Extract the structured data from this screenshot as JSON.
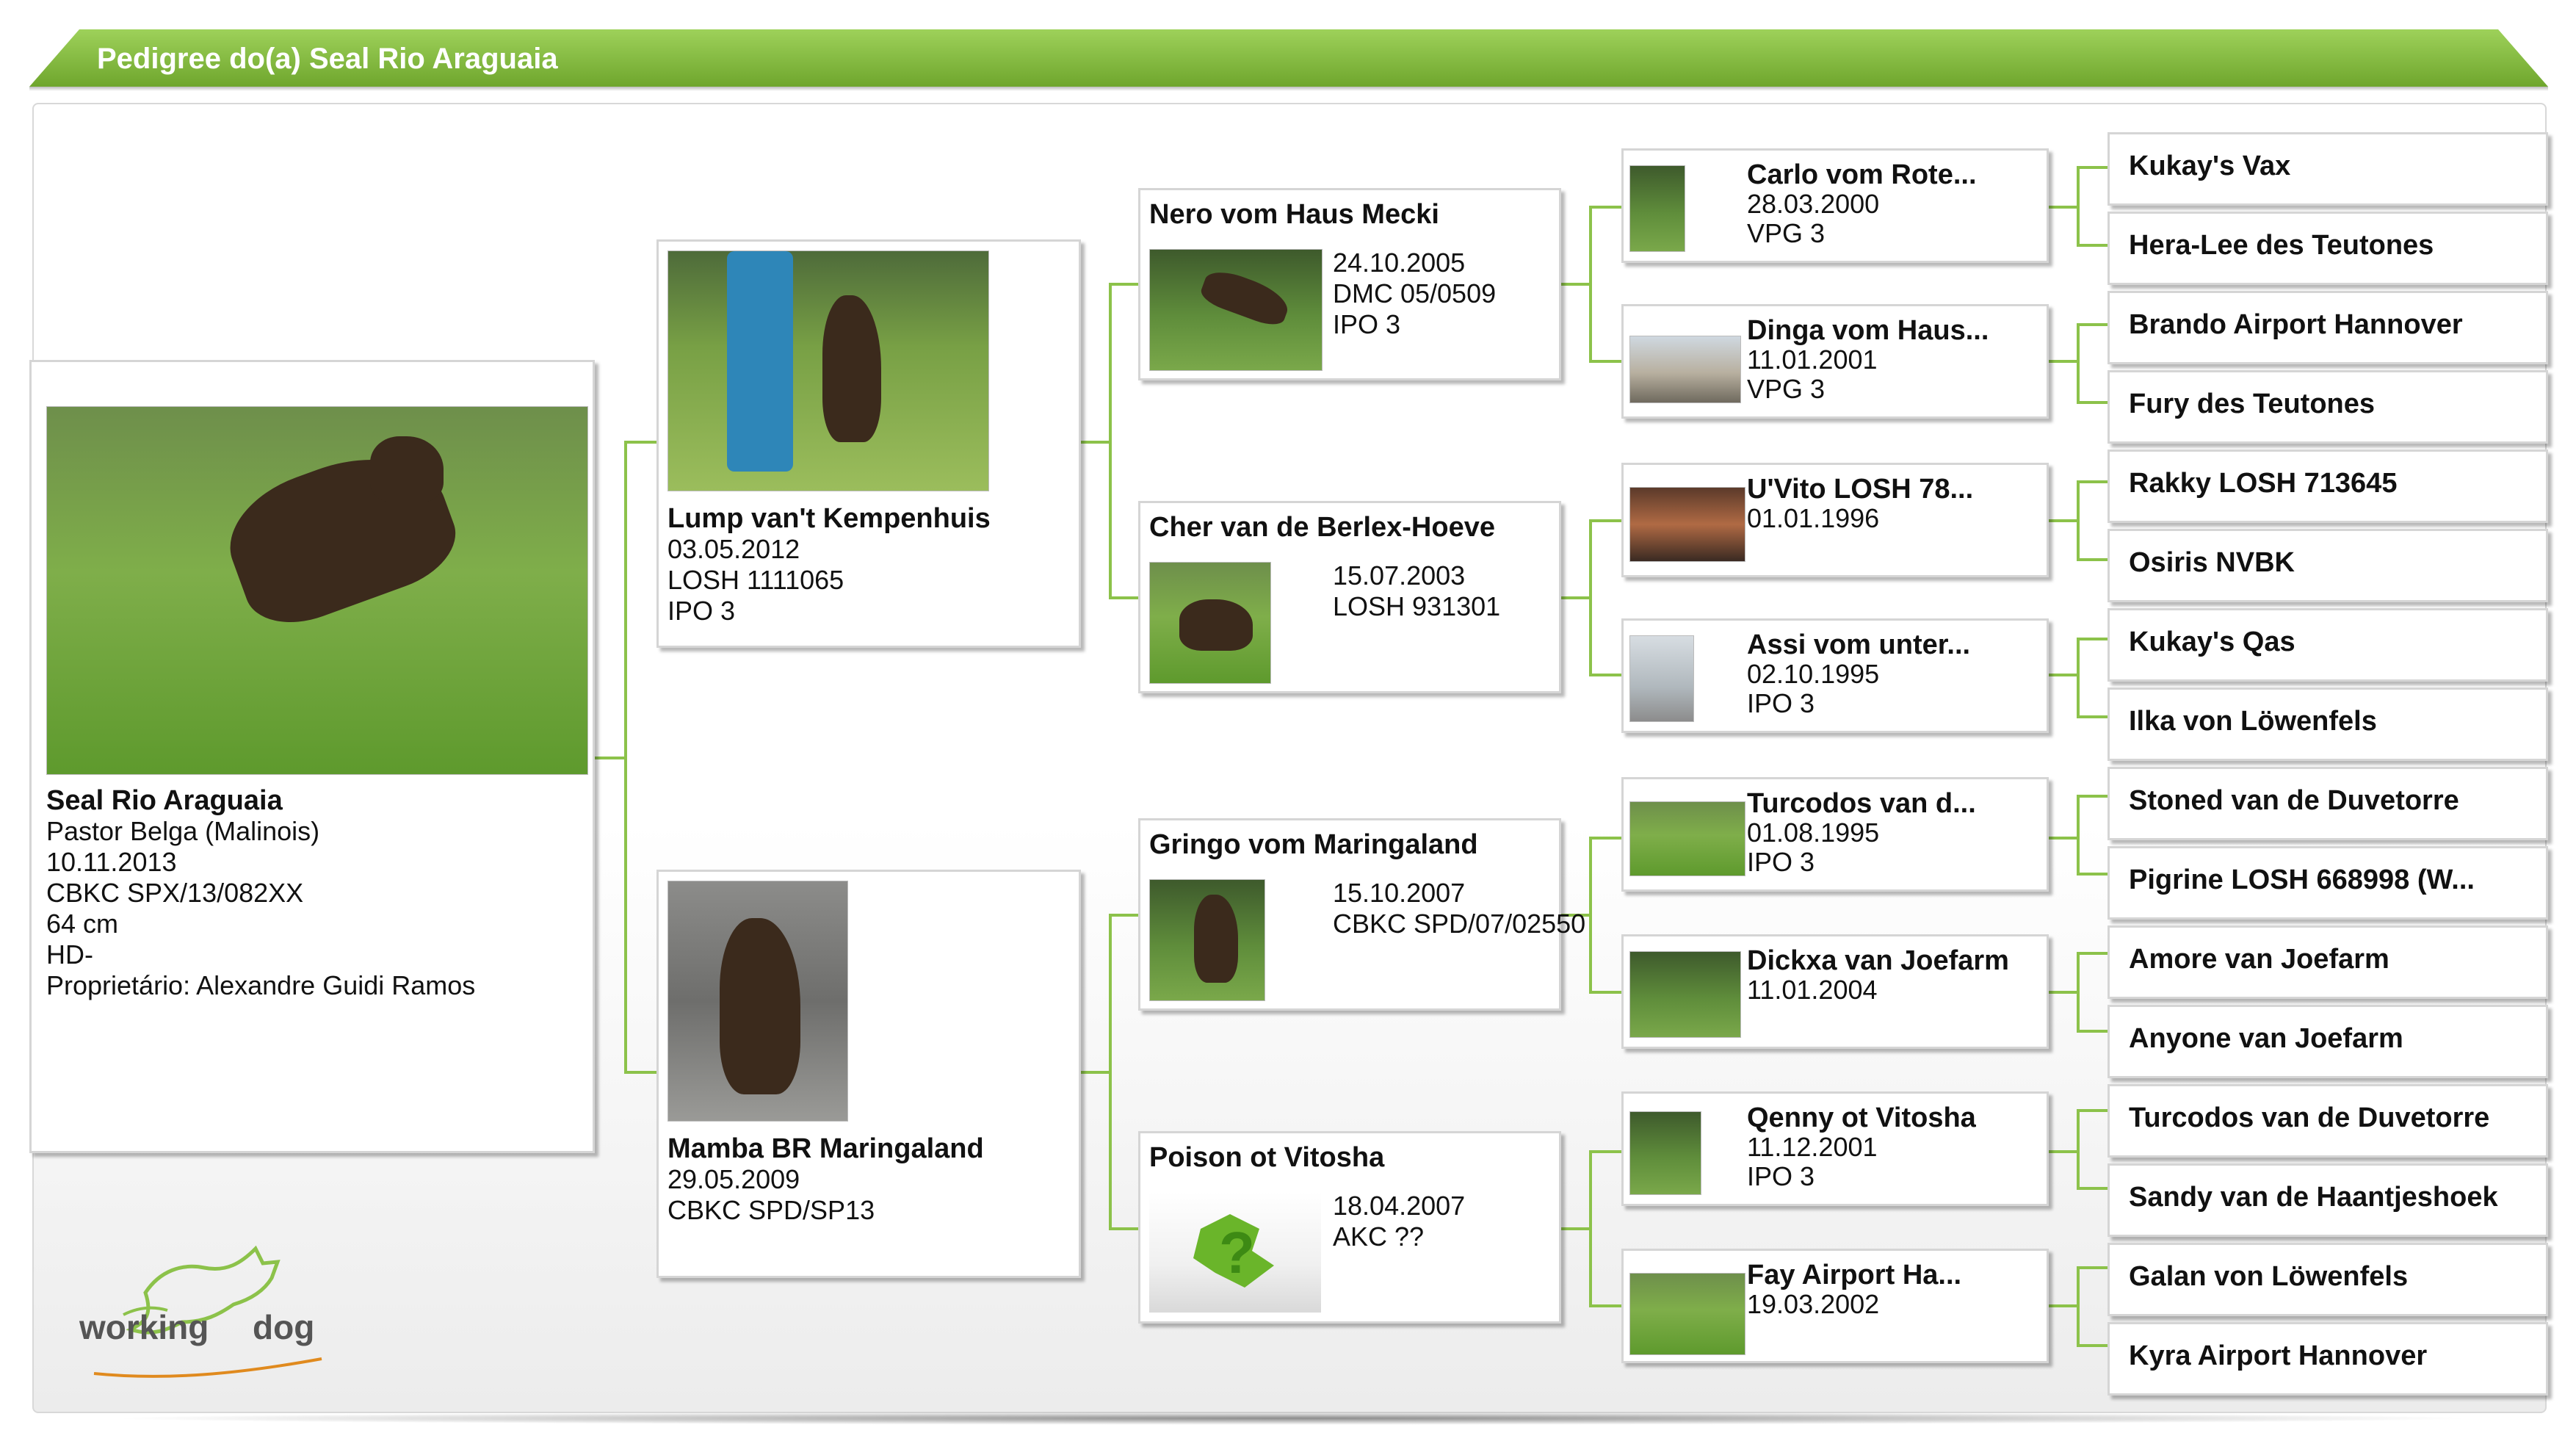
{
  "banner": {
    "title": "Pedigree do(a) Seal Rio Araguaia"
  },
  "subject": {
    "name": "Seal Rio Araguaia",
    "breed": "Pastor Belga (Malinois)",
    "birth": "10.11.2013",
    "registry": "CBKC SPX/13/082XX",
    "height": "64 cm",
    "hd": "HD-",
    "owner": "Proprietário: Alexandre Guidi Ramos"
  },
  "parents": [
    {
      "name": "Lump van't Kempenhuis",
      "birth": "03.05.2012",
      "registry": "LOSH 1111065",
      "title": "IPO 3"
    },
    {
      "name": "Mamba BR Maringaland",
      "birth": "29.05.2009",
      "registry": "CBKC SPD/SP13",
      "title": ""
    }
  ],
  "grandparents": [
    {
      "name": "Nero vom Haus Mecki",
      "birth": "24.10.2005",
      "registry": "DMC 05/0509",
      "title": "IPO 3"
    },
    {
      "name": "Cher van de Berlex-Hoeve",
      "birth": "15.07.2003",
      "registry": "LOSH 931301",
      "title": ""
    },
    {
      "name": "Gringo vom Maringaland",
      "birth": "15.10.2007",
      "registry": " CBKC SPD/07/02550",
      "title": ""
    },
    {
      "name": "Poison ot Vitosha",
      "birth": "18.04.2007",
      "registry": "AKC ??",
      "title": ""
    }
  ],
  "great_grandparents": [
    {
      "name": "Carlo vom Rote...",
      "birth": "28.03.2000",
      "title": "VPG 3"
    },
    {
      "name": "Dinga vom Haus...",
      "birth": "11.01.2001",
      "title": "VPG 3"
    },
    {
      "name": "U'Vito LOSH 78...",
      "birth": "01.01.1996",
      "title": ""
    },
    {
      "name": "Assi vom unter...",
      "birth": "02.10.1995",
      "title": "IPO 3"
    },
    {
      "name": "Turcodos van d...",
      "birth": "01.08.1995",
      "title": "IPO 3"
    },
    {
      "name": "Dickxa van Joefarm",
      "birth": "11.01.2004",
      "title": ""
    },
    {
      "name": "Qenny ot Vitosha",
      "birth": "11.12.2001",
      "title": "IPO 3"
    },
    {
      "name": "Fay Airport Ha...",
      "birth": "19.03.2002",
      "title": ""
    }
  ],
  "g4": [
    "Kukay's Vax",
    "Hera-Lee des Teutones",
    "Brando Airport Hannover",
    "Fury des Teutones",
    "Rakky LOSH 713645",
    "Osiris NVBK",
    "Kukay's Qas",
    "Ilka von Löwenfels",
    "Stoned van de Duvetorre",
    "Pigrine LOSH 668998 (W...",
    "Amore van Joefarm",
    "Anyone van Joefarm",
    "Turcodos van de Duvetorre",
    "Sandy van de Haantjeshoek",
    "Galan von Löwenfels",
    "Kyra Airport Hannover"
  ],
  "logo": {
    "text_left": "working",
    "text_right": "dog"
  },
  "colors": {
    "accent": "#8cc24a",
    "banner": "#7bb33a"
  }
}
